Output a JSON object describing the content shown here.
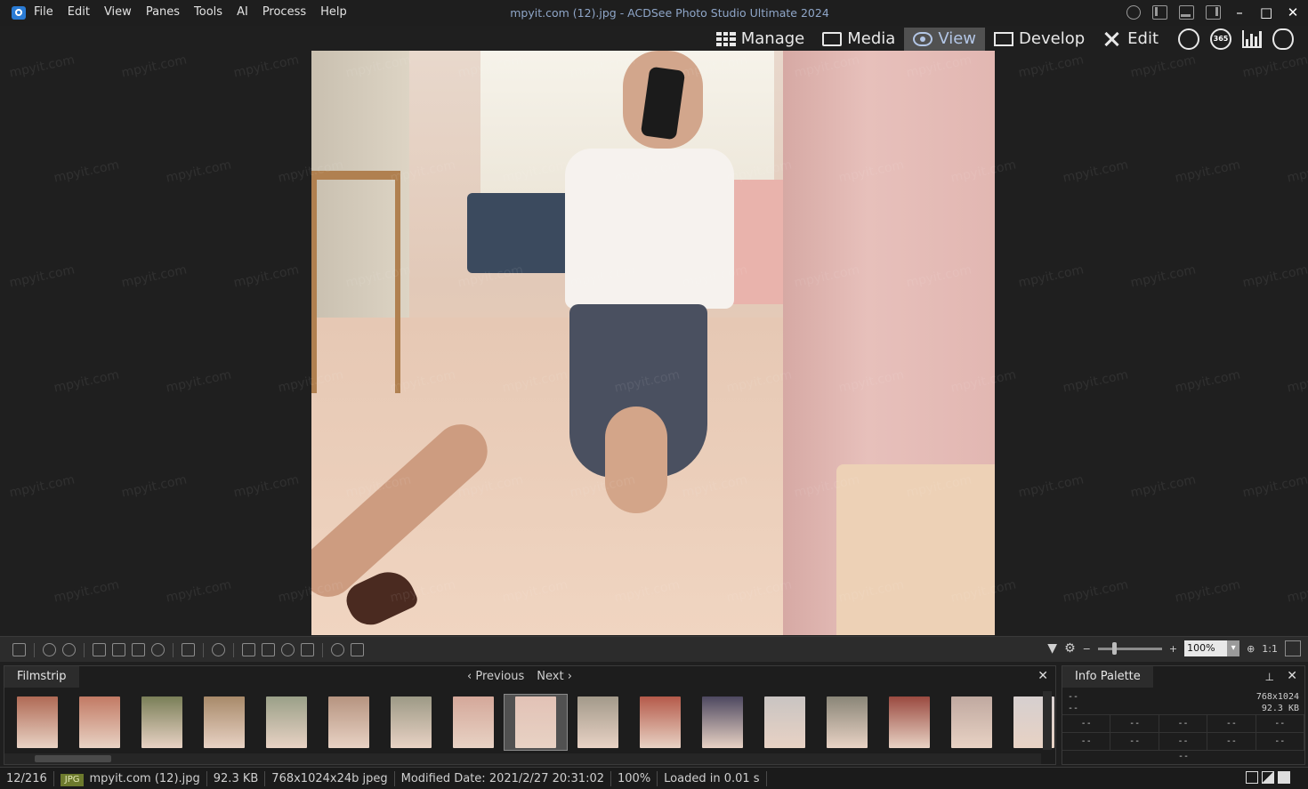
{
  "window": {
    "title": "mpyit.com (12).jpg - ACDSee Photo Studio Ultimate 2024",
    "controls": [
      "–",
      "□",
      "✕"
    ]
  },
  "menu": [
    "File",
    "Edit",
    "View",
    "Panes",
    "Tools",
    "AI",
    "Process",
    "Help"
  ],
  "modes": {
    "manage": "Manage",
    "media": "Media",
    "view": "View",
    "develop": "Develop",
    "edit": "Edit",
    "badge_365": "365"
  },
  "accent": {
    "active_mode_bg": "#515151",
    "active_mode_text": "#b3c6e6",
    "file_badge": "#6d7a2d"
  },
  "watermark_text": "mpyit.com",
  "toolbar": {
    "zoom_value": "100%",
    "actual_size": "1:1"
  },
  "filmstrip": {
    "tab_label": "Filmstrip",
    "previous": "Previous",
    "next": "Next",
    "close": "✕",
    "active_index": 8,
    "thumbnails": [
      {
        "color": "#b06a55"
      },
      {
        "color": "#c27a64"
      },
      {
        "color": "#7a7f58"
      },
      {
        "color": "#a88a6a"
      },
      {
        "color": "#9aa088"
      },
      {
        "color": "#b69480"
      },
      {
        "color": "#9d9a86"
      },
      {
        "color": "#d4a89a"
      },
      {
        "color": "#e2c2b6"
      },
      {
        "color": "#a39a8a"
      },
      {
        "color": "#b55a4a"
      },
      {
        "color": "#4d4860"
      },
      {
        "color": "#c9c4c2"
      },
      {
        "color": "#8a8678"
      },
      {
        "color": "#9a4a40"
      },
      {
        "color": "#c0a9a0"
      },
      {
        "color": "#d6cfcf"
      }
    ]
  },
  "info_palette": {
    "tab_label": "Info Palette",
    "pin": "📌",
    "close": "✕",
    "row1_left": "--",
    "row1_right": "768x1024",
    "row2_left": "--",
    "row2_right": "92.3 KB",
    "grid_row1": [
      "--",
      "--",
      "--",
      "--",
      "--"
    ],
    "grid_row2": [
      "--",
      "--",
      "--",
      "--",
      "--"
    ],
    "footer": "--"
  },
  "status": {
    "position": "12/216",
    "file_type": "JPG",
    "filename": "mpyit.com (12).jpg",
    "size": "92.3 KB",
    "dimensions": "768x1024x24b jpeg",
    "modified": "Modified Date: 2021/2/27 20:31:02",
    "zoom": "100%",
    "load_time": "Loaded in 0.01 s"
  }
}
